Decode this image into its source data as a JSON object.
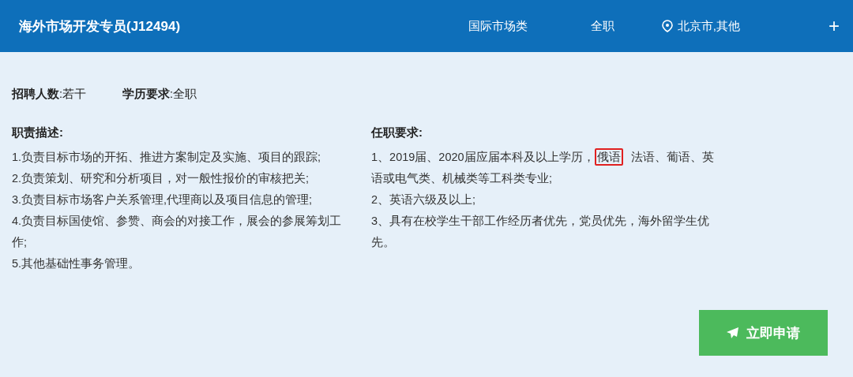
{
  "header": {
    "title": "海外市场开发专员(J12494)",
    "category": "国际市场类",
    "type": "全职",
    "location": "北京市,其他",
    "expand": "+"
  },
  "summary": [
    {
      "label": "招聘人数",
      "value": ":若干"
    },
    {
      "label": "学历要求",
      "value": ":全职"
    }
  ],
  "duties": {
    "heading": "职责描述:",
    "items": [
      "1.负责目标市场的开拓、推进方案制定及实施、项目的跟踪;",
      "2.负责策划、研究和分析项目，对一般性报价的审核把关;",
      "3.负责目标市场客户关系管理,代理商以及项目信息的管理;",
      "4.负责目标国使馆、参赞、商会的对接工作，展会的参展筹划工作;",
      "5.其他基础性事务管理。"
    ]
  },
  "requirements": {
    "heading": "任职要求:",
    "items": [
      [
        {
          "text": "1、2019届、2020届应届本科及以上学历，",
          "highlighted": false
        },
        {
          "text": "俄语",
          "highlighted": true
        },
        {
          "text": "法语、葡语、英语或电气类、机械类等工科类专业;",
          "highlighted": false
        }
      ],
      [
        {
          "text": "2、英语六级及以上;",
          "highlighted": false
        }
      ],
      [
        {
          "text": "3、具有在校学生干部工作经历者优先，党员优先，海外留学生优先。",
          "highlighted": false
        }
      ]
    ]
  },
  "apply_button": "立即申请"
}
